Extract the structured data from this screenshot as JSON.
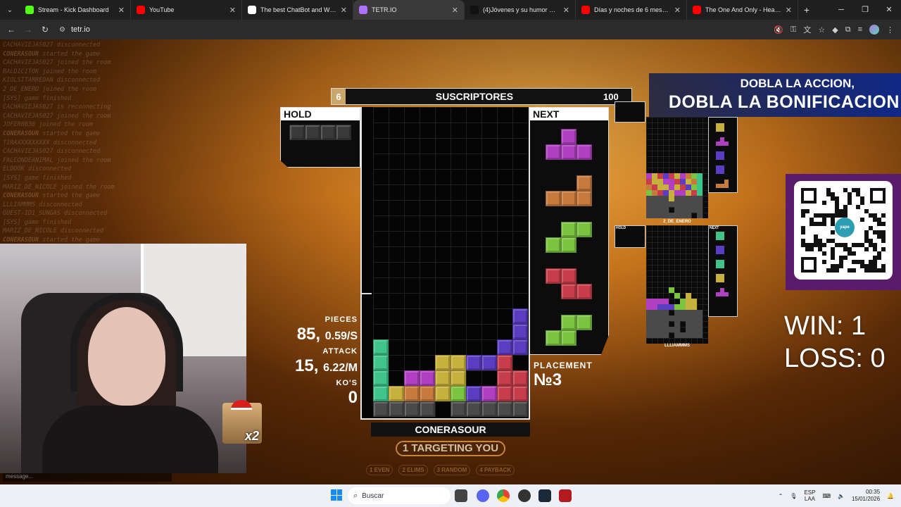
{
  "browser": {
    "tabs": [
      {
        "title": "Stream - Kick Dashboard",
        "favicon_color": "#53fc18",
        "active": false
      },
      {
        "title": "YouTube",
        "favicon_color": "#ff0000",
        "active": false
      },
      {
        "title": "The best ChatBot and Widg",
        "favicon_color": "#ffffff",
        "active": false
      },
      {
        "title": "TETR.IO",
        "favicon_color": "#b070ff",
        "active": true
      },
      {
        "title": "(4)Jóvenes y su humor en el Liv",
        "favicon_color": "#111111",
        "active": false
      },
      {
        "title": "Días y noches de 6 meses - You",
        "favicon_color": "#ff0000",
        "active": false
      },
      {
        "title": "The One And Only - HeatoN (C",
        "favicon_color": "#ff0000",
        "active": false
      }
    ],
    "url": "tetr.io"
  },
  "chat": {
    "lines": [
      {
        "who": "",
        "text": "CACHAVIEJAS027 disconnected"
      },
      {
        "who": "CONERASOUR",
        "text": "started the game"
      },
      {
        "who": "",
        "text": "CACHAVIEJAS027 joined the room"
      },
      {
        "who": "",
        "text": "BALDICITOK joined the room"
      },
      {
        "who": "",
        "text": "KIOLSITARREDAN disconnected"
      },
      {
        "who": "",
        "text": "2_DE_ENERO joined the room"
      },
      {
        "who": "",
        "text": "[SYS] game finished"
      },
      {
        "who": "",
        "text": "CACHAVIEJAS027 is reconnecting"
      },
      {
        "who": "",
        "text": "CACHAVIEJAS027 joined the room"
      },
      {
        "who": "",
        "text": "JOFER0830 joined the room"
      },
      {
        "who": "CONERASOUR",
        "text": "started the game"
      },
      {
        "who": "",
        "text": "TIRAXXXXXXXXX disconnected"
      },
      {
        "who": "",
        "text": "CACHAVIEJAS027 disconnected"
      },
      {
        "who": "",
        "text": "FALCONDEANIMAL joined the room"
      },
      {
        "who": "",
        "text": "ELDOOK disconnected"
      },
      {
        "who": "",
        "text": "[SYS] game finished"
      },
      {
        "who": "",
        "text": "MARIZ_DE_NICOLE joined the room"
      },
      {
        "who": "CONERASOUR",
        "text": "started the game"
      },
      {
        "who": "",
        "text": "LLLIAMMMS disconnected"
      },
      {
        "who": "",
        "text": "GUEST-ID1_SUNGAS disconnected"
      },
      {
        "who": "",
        "text": "[SYS] game finished"
      },
      {
        "who": "",
        "text": "MARIZ_DE_NICOLE disconnected"
      },
      {
        "who": "CONERASOUR",
        "text": "started the game"
      }
    ],
    "placeholder": "message..."
  },
  "game": {
    "header_left": "6",
    "header_title": "SUSCRIPTORES",
    "header_right": "100",
    "hold_label": "HOLD",
    "next_label": "NEXT",
    "stats": {
      "pieces_label": "PIECES",
      "pieces_value": "85,",
      "pieces_rate": "0.59/S",
      "attack_label": "ATTACK",
      "attack_value": "15,",
      "attack_rate": "6.22/M",
      "kos_label": "KO'S",
      "kos_value": "0"
    },
    "placement_label": "PLACEMENT",
    "placement_value": "№3",
    "player_name": "CONERASOUR",
    "targeting": "1 TARGETING YOU",
    "strategies": [
      "1 EVEN",
      "2 ELIMS",
      "3 RANDOM",
      "4 PAYBACK"
    ],
    "colors": {
      "I": "#3fc58a",
      "O": "#c7b13d",
      "T": "#b13fc1",
      "L": "#c77a3d",
      "S": "#7ac43f",
      "Z": "#c73d4b",
      "J": "#5b3dc1",
      "G": "#4a4a4a"
    }
  },
  "opponents": [
    {
      "name": "2_DE_ENERO"
    },
    {
      "name": "LLLIAMMMS",
      "hold_label": "HOLD",
      "next_label": "NEXT"
    }
  ],
  "overlay": {
    "banner_line1": "DOBLA LA ACCION,",
    "banner_line2": "DOBLA LA BONIFICACION",
    "qr_logo": "yape",
    "win": "WIN: 1",
    "loss": "LOSS: 0",
    "badge": "x2"
  },
  "taskbar": {
    "search_placeholder": "Buscar",
    "lang_top": "ESP",
    "lang_bottom": "LAA",
    "time": "00:35",
    "date": "15/01/2026"
  }
}
